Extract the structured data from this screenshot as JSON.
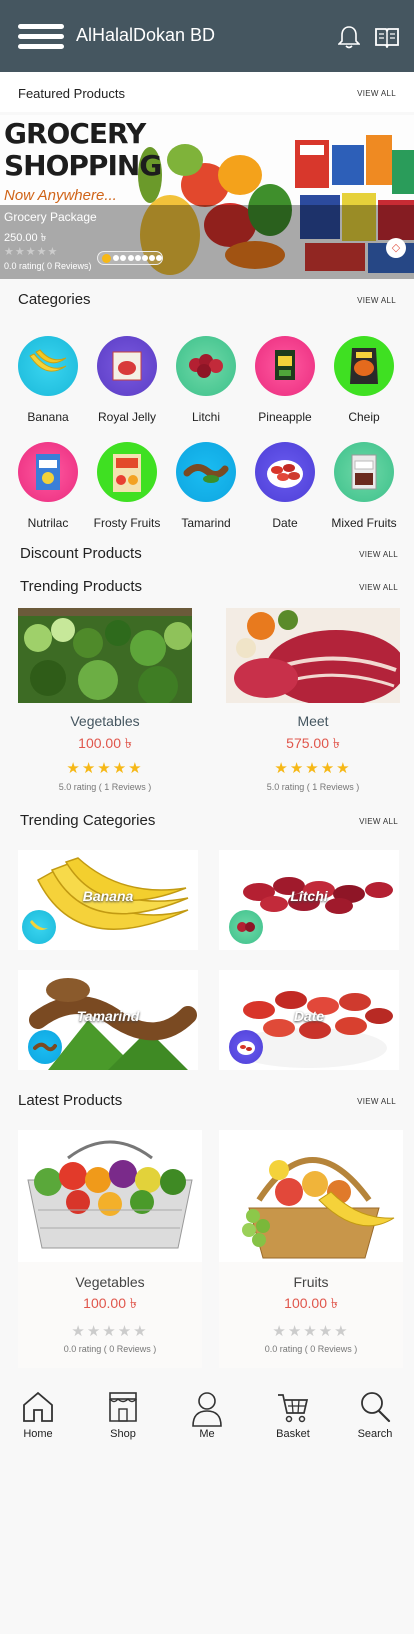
{
  "app": {
    "title": "AlHalalDokan BD"
  },
  "featured": {
    "title": "Featured Products",
    "view_all": "VIEW ALL",
    "banner": {
      "headline_line1": "GROCERY",
      "headline_line2": "SHOPPING",
      "subline": "Now Anywhere...",
      "name": "Grocery Package",
      "price": "250.00 ৳",
      "stars": "★★★★★",
      "rating": "0.0 rating( 0 Reviews)",
      "slide_count": 8,
      "active_slide": 1
    }
  },
  "categories": {
    "title": "Categories",
    "view_all": "VIEW ALL",
    "items": [
      {
        "name": "Banana",
        "icon": "banana-icon"
      },
      {
        "name": "Royal Jelly",
        "icon": "jelly-icon"
      },
      {
        "name": "Litchi",
        "icon": "litchi-icon"
      },
      {
        "name": "Pineapple",
        "icon": "pineapple-icon"
      },
      {
        "name": "Cheip",
        "icon": "chips-icon"
      },
      {
        "name": "Nutrilac",
        "icon": "nutrilac-icon"
      },
      {
        "name": "Frosty Fruits",
        "icon": "frosty-fruits-icon"
      },
      {
        "name": "Tamarind",
        "icon": "tamarind-icon"
      },
      {
        "name": "Date",
        "icon": "date-icon"
      },
      {
        "name": "Mixed Fruits",
        "icon": "mixed-fruits-icon"
      }
    ]
  },
  "discount": {
    "title": "Discount Products",
    "view_all": "VIEW ALL"
  },
  "trending_products": {
    "title": "Trending Products",
    "view_all": "VIEW ALL",
    "items": [
      {
        "name": "Vegetables",
        "price": "100.00 ৳",
        "stars": "★★★★★",
        "rating": "5.0 rating ( 1 Reviews )"
      },
      {
        "name": "Meet",
        "price": "575.00 ৳",
        "stars": "★★★★★",
        "rating": "5.0 rating ( 1 Reviews )"
      }
    ]
  },
  "trending_categories": {
    "title": "Trending Categories",
    "view_all": "VIEW ALL",
    "items": [
      {
        "name": "Banana"
      },
      {
        "name": "Litchi"
      },
      {
        "name": "Tamarind"
      },
      {
        "name": "Date"
      }
    ]
  },
  "latest": {
    "title": "Latest Products",
    "view_all": "VIEW ALL",
    "items": [
      {
        "name": "Vegetables",
        "price": "100.00 ৳",
        "stars": "★★★★★",
        "rating": "0.0 rating ( 0 Reviews )"
      },
      {
        "name": "Fruits",
        "price": "100.00 ৳",
        "stars": "★★★★★",
        "rating": "0.0 rating ( 0 Reviews )"
      }
    ]
  },
  "nav": {
    "items": [
      {
        "label": "Home",
        "icon": "home-icon"
      },
      {
        "label": "Shop",
        "icon": "shop-icon"
      },
      {
        "label": "Me",
        "icon": "user-icon"
      },
      {
        "label": "Basket",
        "icon": "cart-icon"
      },
      {
        "label": "Search",
        "icon": "search-icon"
      }
    ]
  },
  "colors": {
    "appbar": "#455660",
    "price": "#e0564c",
    "star": "#f6b817",
    "name": "#455660"
  }
}
